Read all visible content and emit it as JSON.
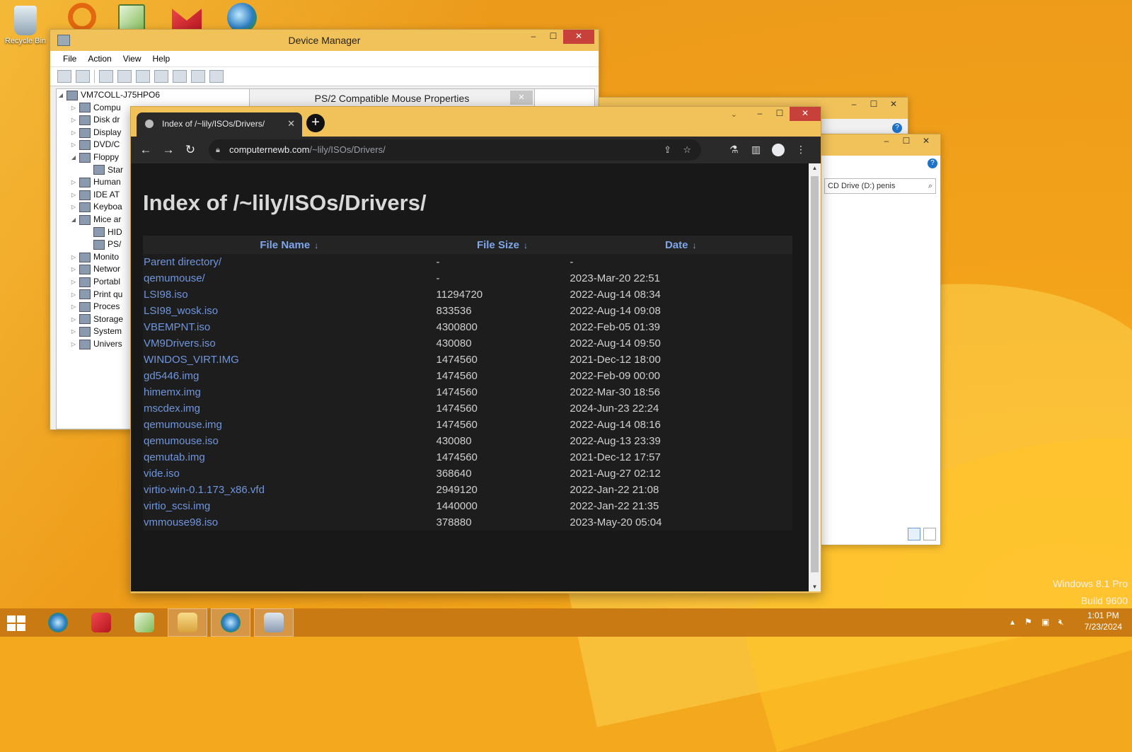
{
  "desktop": {
    "icons": [
      {
        "label": "Recycle Bin",
        "icon": "recycle-bin-icon"
      },
      {
        "label": "",
        "icon": "app-ring-icon"
      },
      {
        "label": "",
        "icon": "notepad-plus-icon"
      },
      {
        "label": "",
        "icon": "winrar-icon"
      },
      {
        "label": "",
        "icon": "chrome-icon"
      }
    ],
    "watermark_line1": "Windows 8.1 Pro",
    "watermark_line2": "Build 9600"
  },
  "device_manager": {
    "title": "Device Manager",
    "menu": [
      "File",
      "Action",
      "View",
      "Help"
    ],
    "tree_root": "VM7COLL-J75HPO6",
    "tree": [
      "Compu",
      "Disk dr",
      "Display",
      "DVD/C",
      "Floppy",
      "Star",
      "Human",
      "IDE AT",
      "Keyboa",
      "Mice ar",
      "HID",
      "PS/",
      "Monito",
      "Networ",
      "Portabl",
      "Print qu",
      "Proces",
      "Storage",
      "System",
      "Univers"
    ]
  },
  "ps2_dialog": {
    "title": "PS/2 Compatible Mouse Properties",
    "close": "✕"
  },
  "explorer": {
    "search_value": "CD Drive (D:) penis"
  },
  "browser": {
    "tab_title": "Index of /~lily/ISOs/Drivers/",
    "url_host": "computernewb.com",
    "url_path": "/~lily/ISOs/Drivers/",
    "heading": "Index of /~lily/ISOs/Drivers/",
    "columns": [
      "File Name",
      "File Size",
      "Date"
    ],
    "sort_arrow": "↓",
    "rows": [
      {
        "name": "Parent directory/",
        "size": "-",
        "date": "-"
      },
      {
        "name": "qemumouse/",
        "size": "-",
        "date": "2023-Mar-20 22:51"
      },
      {
        "name": "LSI98.iso",
        "size": "11294720",
        "date": "2022-Aug-14 08:34"
      },
      {
        "name": "LSI98_wosk.iso",
        "size": "833536",
        "date": "2022-Aug-14 09:08"
      },
      {
        "name": "VBEMPNT.iso",
        "size": "4300800",
        "date": "2022-Feb-05 01:39"
      },
      {
        "name": "VM9Drivers.iso",
        "size": "430080",
        "date": "2022-Aug-14 09:50"
      },
      {
        "name": "WINDOS_VIRT.IMG",
        "size": "1474560",
        "date": "2021-Dec-12 18:00"
      },
      {
        "name": "gd5446.img",
        "size": "1474560",
        "date": "2022-Feb-09 00:00"
      },
      {
        "name": "himemx.img",
        "size": "1474560",
        "date": "2022-Mar-30 18:56"
      },
      {
        "name": "mscdex.img",
        "size": "1474560",
        "date": "2024-Jun-23 22:24"
      },
      {
        "name": "qemumouse.img",
        "size": "1474560",
        "date": "2022-Aug-14 08:16"
      },
      {
        "name": "qemumouse.iso",
        "size": "430080",
        "date": "2022-Aug-13 23:39"
      },
      {
        "name": "qemutab.img",
        "size": "1474560",
        "date": "2021-Dec-12 17:57"
      },
      {
        "name": "vide.iso",
        "size": "368640",
        "date": "2021-Aug-27 02:12"
      },
      {
        "name": "virtio-win-0.1.173_x86.vfd",
        "size": "2949120",
        "date": "2022-Jan-22 21:08"
      },
      {
        "name": "virtio_scsi.img",
        "size": "1440000",
        "date": "2022-Jan-22 21:35"
      },
      {
        "name": "vmmouse98.iso",
        "size": "378880",
        "date": "2023-May-20 05:04"
      }
    ]
  },
  "taskbar": {
    "clock_time": "1:01 PM",
    "clock_date": "7/23/2024",
    "apps": [
      "chrome-icon",
      "winrar-icon",
      "notepad-plus-icon",
      "file-explorer-icon",
      "chrome-active-icon",
      "device-manager-icon"
    ]
  },
  "colors": {
    "accent": "#f2c25a",
    "link": "#6f95dc",
    "page_bg": "#181818",
    "taskbar": "#c97a12"
  }
}
